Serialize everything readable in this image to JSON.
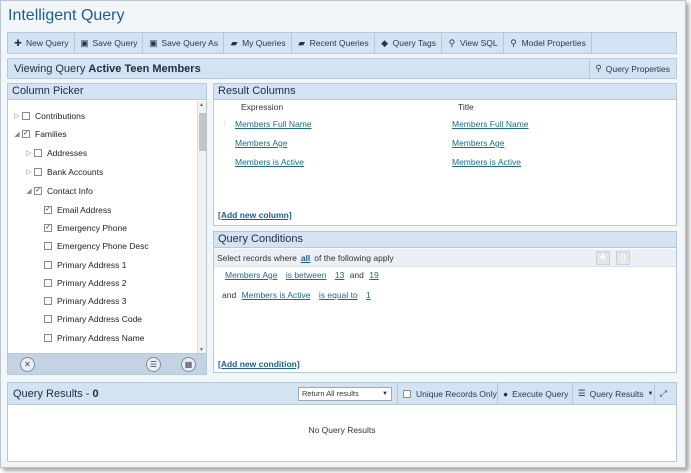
{
  "app": {
    "title": "Intelligent Query"
  },
  "toolbar": {
    "items": [
      {
        "label": "New Query",
        "icon": "plus-icon"
      },
      {
        "label": "Save Query",
        "icon": "floppy-icon"
      },
      {
        "label": "Save Query As",
        "icon": "floppy-icon"
      },
      {
        "label": "My Queries",
        "icon": "folder-open-icon"
      },
      {
        "label": "Recent Queries",
        "icon": "folder-open-icon"
      },
      {
        "label": "Query Tags",
        "icon": "tag-icon"
      },
      {
        "label": "View SQL",
        "icon": "search-icon"
      },
      {
        "label": "Model Properties",
        "icon": "search-icon"
      }
    ]
  },
  "viewbar": {
    "prefix": "Viewing Query",
    "query_name": "Active Teen Members",
    "properties_label": "Query Properties"
  },
  "column_picker": {
    "title": "Column Picker",
    "tree": [
      {
        "label": "Contributions",
        "expanded": false,
        "checked": false
      },
      {
        "label": "Families",
        "expanded": true,
        "checked": true
      },
      {
        "label": "Addresses",
        "expanded": false,
        "checked": false
      },
      {
        "label": "Bank Accounts",
        "expanded": false,
        "checked": false
      },
      {
        "label": "Contact Info",
        "expanded": true,
        "checked": true
      },
      {
        "label": "Email Address",
        "checked": true
      },
      {
        "label": "Emergency Phone",
        "checked": true
      },
      {
        "label": "Emergency Phone Desc",
        "checked": false
      },
      {
        "label": "Primary Address 1",
        "checked": false
      },
      {
        "label": "Primary Address 2",
        "checked": false
      },
      {
        "label": "Primary Address 3",
        "checked": false
      },
      {
        "label": "Primary Address Code",
        "checked": false
      },
      {
        "label": "Primary Address Name",
        "checked": false
      }
    ]
  },
  "result_columns": {
    "title": "Result Columns",
    "headers": {
      "expression": "Expression",
      "title": "Title"
    },
    "rows": [
      {
        "expression": "Members Full Name",
        "title": "Members Full Name"
      },
      {
        "expression": "Members Age",
        "title": "Members Age"
      },
      {
        "expression": "Members is Active",
        "title": "Members is Active"
      }
    ],
    "add_label": "[Add new column]"
  },
  "query_conditions": {
    "title": "Query Conditions",
    "select_prefix": "Select records where",
    "match_mode": "all",
    "select_suffix": "of the following apply",
    "conditions": [
      {
        "joiner": "",
        "field": "Members Age",
        "operator": "is between",
        "value1": "13",
        "and": "and",
        "value2": "19"
      },
      {
        "joiner": "and",
        "field": "Members is Active",
        "operator": "is equal to",
        "value1": "1"
      }
    ],
    "add_label": "[Add new condition]"
  },
  "query_results": {
    "title_prefix": "Query Results -",
    "count": "0",
    "return_option": "Return All results",
    "unique_label": "Unique Records Only",
    "execute_label": "Execute Query",
    "results_menu_label": "Query Results",
    "empty_text": "No Query Results"
  }
}
